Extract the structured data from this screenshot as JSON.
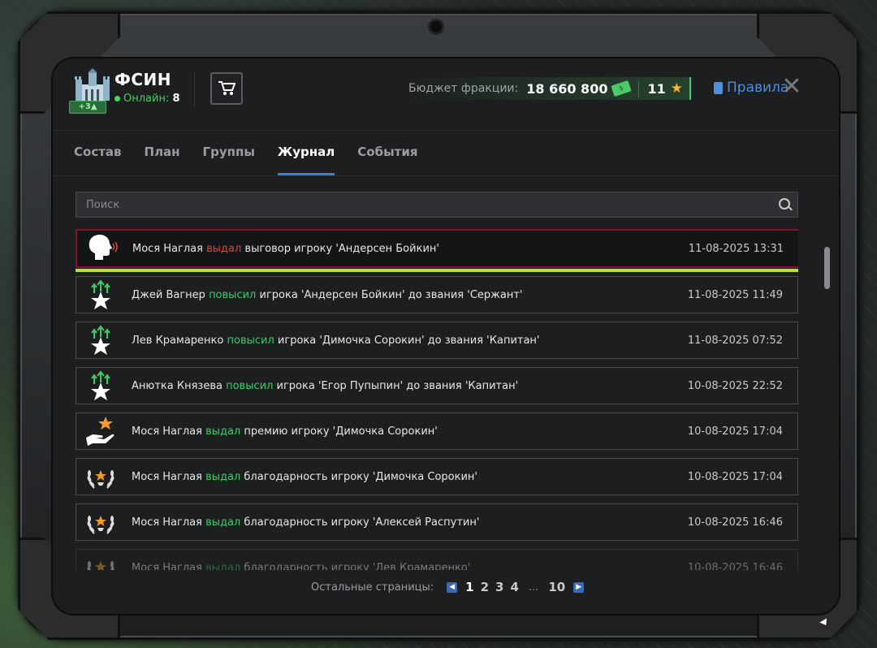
{
  "faction": {
    "name": "ФСИН",
    "badge": "+3▲",
    "online_label": "Онлайн:",
    "online_count": "8"
  },
  "budget": {
    "label": "Бюджет фракции:",
    "value": "18 660 800",
    "stars": "11"
  },
  "rules_label": "Правила",
  "tabs": [
    {
      "label": "Состав"
    },
    {
      "label": "План"
    },
    {
      "label": "Группы"
    },
    {
      "label": "Журнал",
      "active": true
    },
    {
      "label": "События"
    }
  ],
  "search": {
    "placeholder": "Поиск"
  },
  "log": [
    {
      "icon": "speech-icon",
      "actor": "Мося Наглая",
      "verb": "выдал",
      "verb_color": "red",
      "rest": " выговор игроку 'Андерсен Бойкин'",
      "time": "11-08-2025 13:31",
      "selected": true
    },
    {
      "icon": "promotion-star-icon",
      "actor": "Джей Вагнер",
      "verb": "повысил",
      "verb_color": "green",
      "rest": " игрока 'Андерсен Бойкин' до звания 'Сержант'",
      "time": "11-08-2025 11:49"
    },
    {
      "icon": "promotion-star-icon",
      "actor": "Лев Крамаренко",
      "verb": "повысил",
      "verb_color": "green",
      "rest": " игрока 'Димочка Сорокин' до звания 'Капитан'",
      "time": "11-08-2025 07:52"
    },
    {
      "icon": "promotion-star-icon",
      "actor": "Анютка Князева",
      "verb": "повысил",
      "verb_color": "green",
      "rest": " игрока 'Егор Пупыпин' до звания 'Капитан'",
      "time": "10-08-2025 22:52"
    },
    {
      "icon": "bonus-hand-icon",
      "actor": "Мося Наглая",
      "verb": "выдал",
      "verb_color": "green",
      "rest": " премию игроку 'Димочка Сорокин'",
      "time": "10-08-2025 17:04"
    },
    {
      "icon": "laurel-icon",
      "actor": "Мося Наглая",
      "verb": "выдал",
      "verb_color": "green",
      "rest": " благодарность игроку 'Димочка Сорокин'",
      "time": "10-08-2025 17:04"
    },
    {
      "icon": "laurel-icon",
      "actor": "Мося Наглая",
      "verb": "выдал",
      "verb_color": "green",
      "rest": " благодарность игроку 'Алексей Распутин'",
      "time": "10-08-2025 16:46"
    },
    {
      "icon": "laurel-icon",
      "actor": "Мося Наглая",
      "verb": "выдал",
      "verb_color": "green",
      "rest": " благодарность игроку 'Лев Крамаренко'",
      "time": "10-08-2025 16:46",
      "faded": true
    }
  ],
  "pagination": {
    "label": "Остальные страницы:",
    "pages": [
      "1",
      "2",
      "3",
      "4"
    ],
    "ellipsis": "...",
    "last": "10"
  },
  "colors": {
    "accent_blue": "#3f7fd6",
    "green": "#3fca6a",
    "red": "#e2453a",
    "selected_outline": "#b8e032"
  }
}
